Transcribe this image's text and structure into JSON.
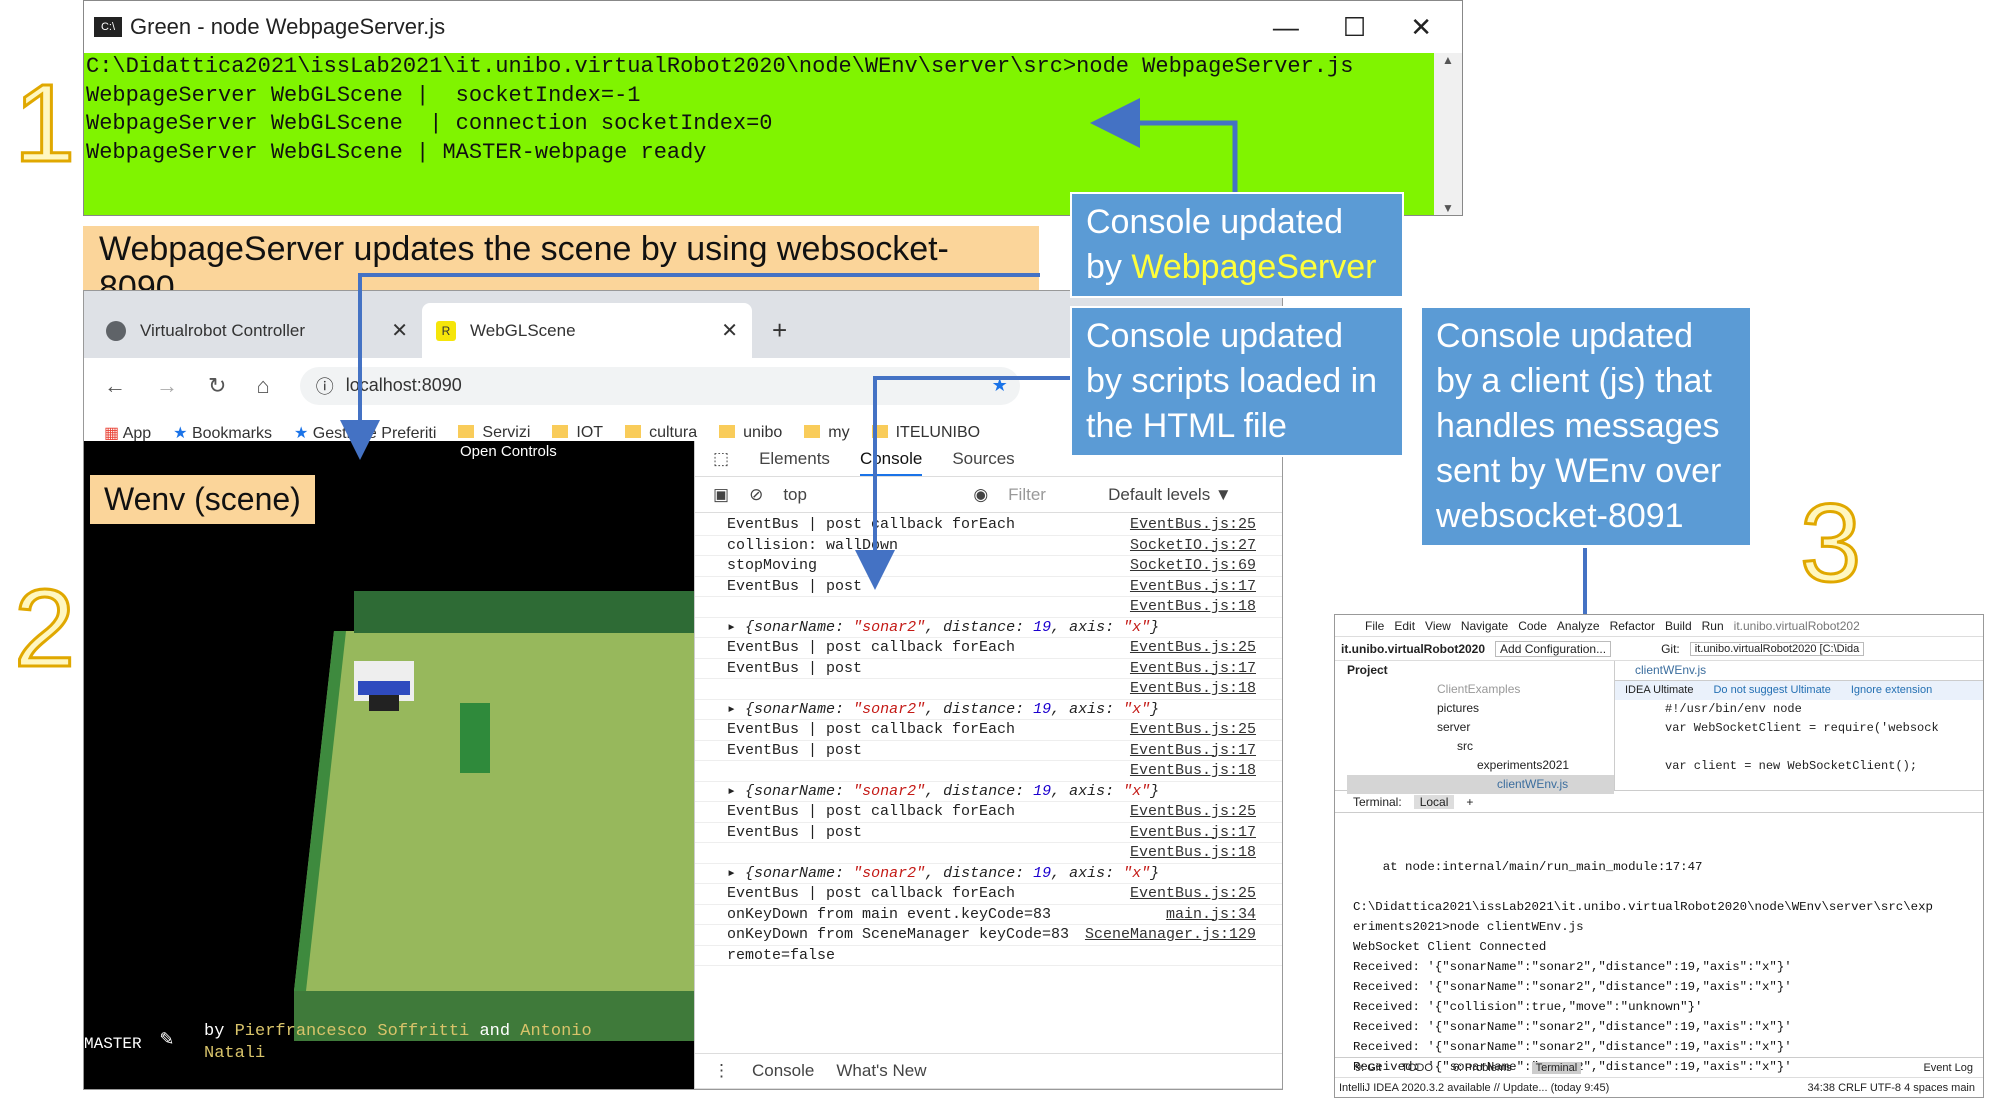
{
  "numbers": {
    "n1": "1",
    "n2": "2",
    "n3": "3"
  },
  "term1": {
    "title": "Green - node  WebpageServer.js",
    "icon": "C:\\",
    "minimize": "—",
    "maximize": "☐",
    "close": "✕",
    "lines": [
      "C:\\Didattica2021\\issLab2021\\it.unibo.virtualRobot2020\\node\\WEnv\\server\\src>node WebpageServer.js",
      "WebpageServer WebGLScene |  socketIndex=-1",
      "WebpageServer WebGLScene  | connection socketIndex=0",
      "WebpageServer WebGLScene | MASTER-webpage ready"
    ]
  },
  "banner": "WebpageServer updates the scene by using websocket-8090",
  "callouts": {
    "c1a": "Console updated",
    "c1b": "by ",
    "c1hl": "WebpageServer",
    "c2a": "Console updated",
    "c2b": "by scripts loaded in",
    "c2c": "the HTML file",
    "c3": [
      "Console updated",
      "by a client (js) that",
      "handles messages",
      "sent by WEnv over",
      "websocket-8091"
    ]
  },
  "browser": {
    "tab1": "Virtualrobot Controller",
    "tab2": "WebGLScene",
    "tab2fav": "R",
    "newtab": "+",
    "url": "localhost:8090",
    "bookmarks": [
      "App",
      "Bookmarks",
      "Gestione Preferiti",
      "Servizi",
      "IOT",
      "cultura",
      "unibo",
      "my",
      "ITELUNIBO"
    ]
  },
  "scene": {
    "open_controls": "Open Controls",
    "label": "Wenv (scene)",
    "master": "MASTER",
    "by": "by ",
    "author1": "Pierfrancesco Soffritti",
    "and": " and ",
    "author2a": "Antonio",
    "author2b": "Natali"
  },
  "devtools": {
    "tabs": [
      "Elements",
      "Console",
      "Sources"
    ],
    "context": "top",
    "filter": "Filter",
    "levels": "Default levels ▼",
    "log": [
      {
        "t": "EventBus | post callback forEach",
        "s": "EventBus.js:25"
      },
      {
        "t": "collision: wallDown",
        "s": "SocketIO.js:27"
      },
      {
        "t": "stopMoving",
        "s": "SocketIO.js:69"
      },
      {
        "t": "EventBus | post",
        "s": "EventBus.js:17"
      },
      {
        "t": "",
        "s": "EventBus.js:18"
      },
      {
        "t": "obj",
        "s": ""
      },
      {
        "t": "EventBus | post callback forEach",
        "s": "EventBus.js:25"
      },
      {
        "t": "EventBus | post",
        "s": "EventBus.js:17"
      },
      {
        "t": "",
        "s": "EventBus.js:18"
      },
      {
        "t": "obj",
        "s": ""
      },
      {
        "t": "EventBus | post callback forEach",
        "s": "EventBus.js:25"
      },
      {
        "t": "EventBus | post",
        "s": "EventBus.js:17"
      },
      {
        "t": "",
        "s": "EventBus.js:18"
      },
      {
        "t": "obj",
        "s": ""
      },
      {
        "t": "EventBus | post callback forEach",
        "s": "EventBus.js:25"
      },
      {
        "t": "EventBus | post",
        "s": "EventBus.js:17"
      },
      {
        "t": "",
        "s": "EventBus.js:18"
      },
      {
        "t": "obj",
        "s": ""
      },
      {
        "t": "EventBus | post callback forEach",
        "s": "EventBus.js:25"
      },
      {
        "t": "onKeyDown from main event.keyCode=83",
        "s": "main.js:34"
      },
      {
        "t": "onKeyDown from SceneManager keyCode=83",
        "s": "SceneManager.js:129"
      },
      {
        "t": "remote=false",
        "s": ""
      }
    ],
    "obj": {
      "a": "▸ {sonarName: ",
      "b": "\"sonar2\"",
      "c": ", distance: ",
      "d": "19",
      "e": ", axis: ",
      "f": "\"x\"",
      "g": "}"
    },
    "drawer": [
      "Console",
      "What's New"
    ]
  },
  "ide": {
    "menu": [
      "File",
      "Edit",
      "View",
      "Navigate",
      "Code",
      "Analyze",
      "Refactor",
      "Build",
      "Run",
      "it.unibo.virtualRobot202"
    ],
    "project": "it.unibo.virtualRobot2020",
    "addconf": "Add Configuration...",
    "git": "Git:",
    "tooltip": "it.unibo.virtualRobot2020 [C:\\Dida",
    "tree": [
      "ClientExamples",
      "pictures",
      "server",
      "src",
      "experiments2021",
      "clientWEnv.js"
    ],
    "proj_label": "Project",
    "editor_tab": "clientWEnv.js",
    "ultimate": "IDEA Ultimate",
    "dont": "Do not suggest Ultimate",
    "ignore": "Ignore extension",
    "code": [
      "#!/usr/bin/env node",
      "var WebSocketClient = require('websock",
      "",
      "var client = new WebSocketClient();"
    ],
    "terminal": "Terminal:",
    "local": "Local",
    "lines": [
      "    at node:internal/main/run_main_module:17:47",
      "",
      "C:\\Didattica2021\\issLab2021\\it.unibo.virtualRobot2020\\node\\WEnv\\server\\src\\exp",
      "eriments2021>node clientWEnv.js",
      "WebSocket Client Connected",
      "Received: '{\"sonarName\":\"sonar2\",\"distance\":19,\"axis\":\"x\"}'",
      "Received: '{\"sonarName\":\"sonar2\",\"distance\":19,\"axis\":\"x\"}'",
      "Received: '{\"collision\":true,\"move\":\"unknown\"}'",
      "Received: '{\"sonarName\":\"sonar2\",\"distance\":19,\"axis\":\"x\"}'",
      "Received: '{\"sonarName\":\"sonar2\",\"distance\":19,\"axis\":\"x\"}'",
      "Received: '{\"sonarName\":\"sonar2\",\"distance\":19,\"axis\":\"x\"}'"
    ],
    "bottom": [
      "9: Git",
      "TODO",
      "6: Problems",
      "Terminal",
      "Event Log"
    ],
    "status": "IntelliJ IDEA 2020.3.2 available // Update... (today 9:45)",
    "status_r": "34:38  CRLF  UTF-8  4 spaces  main"
  }
}
